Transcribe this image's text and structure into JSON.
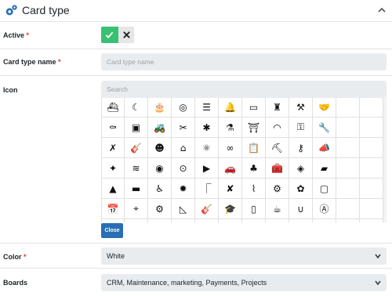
{
  "header": {
    "title": "Card type"
  },
  "form": {
    "active": {
      "label": "Active",
      "required": "*"
    },
    "name": {
      "label": "Card type name",
      "required": "*",
      "placeholder": "Card type name"
    },
    "icon": {
      "label": "Icon",
      "search_placeholder": "Search"
    },
    "close_label": "Close",
    "color": {
      "label": "Color",
      "required": "*",
      "value": "White"
    },
    "boards": {
      "label": "Boards",
      "value": "CRM, Maintenance, marketing, Payments, Projects"
    }
  },
  "icons": [
    "ship-icon",
    "moon-icon",
    "cake-icon",
    "coins-icon",
    "sliders-icon",
    "bell-icon",
    "vr-glasses-icon",
    "lighthouse-icon",
    "gavel-icon",
    "handshake-icon",
    "extra-icon",
    "extra-icon",
    "coffin-icon",
    "window-icon",
    "tractor-icon",
    "tools-icon",
    "bug-icon",
    "flask-icon",
    "monument-icon",
    "wifi-icon",
    "fence-icon",
    "wrench-icon",
    "extra-icon",
    "extra-icon",
    "utensils-icon",
    "guitar-icon",
    "brain-icon",
    "mushroom-icon",
    "atom-icon",
    "binoculars-icon",
    "clipboard-icon",
    "excavator-icon",
    "key-icon",
    "megaphone-icon",
    "extra-icon",
    "extra-icon",
    "magic-wand-icon",
    "swimming-pool-icon",
    "dinosaur-icon",
    "search-user-icon",
    "play-circle-icon",
    "car-icon",
    "plant-icon",
    "toolbox-icon",
    "compass-icon",
    "wallet-icon",
    "extra-icon",
    "extra-icon",
    "traffic-cone-icon",
    "truck-icon",
    "wheelchair-icon",
    "gear-badge-icon",
    "pipe-icon",
    "ruler-pencil-icon",
    "shower-icon",
    "lawn-mower-icon",
    "frog-icon",
    "cube-icon",
    "extra-icon",
    "extra-icon",
    "calendar-check-icon",
    "telescope-icon",
    "engine-icon",
    "note-icon",
    "guitar-icon",
    "graduation-cap-icon",
    "door-icon",
    "cup-icon",
    "magnet-icon",
    "ai-icon",
    "extra-icon",
    "extra-icon",
    "misc-icon",
    "misc-icon",
    "misc-icon",
    "misc-icon",
    "misc-icon",
    "misc-icon",
    "misc-icon",
    "misc-icon",
    "misc-icon",
    "misc-icon",
    "misc-icon",
    "misc-icon"
  ],
  "icon_glyphs": [
    "⛴",
    "☾",
    "🎂",
    "◎",
    "☰",
    "🔔",
    "▭",
    "♜",
    "⚒",
    "🤝",
    "",
    "",
    "⚰",
    "▣",
    "🚜",
    "✂",
    "✱",
    "⚗",
    "⛩",
    "◠",
    "⚿",
    "🔧",
    "",
    "",
    "✗",
    "🎸",
    "☻",
    "⌂",
    "⚛",
    "∞",
    "📋",
    "⛏",
    "⚷",
    "📣",
    "",
    "",
    "✦",
    "≋",
    "◉",
    "⊙",
    "▶",
    "🚗",
    "♣",
    "🧰",
    "◈",
    "▰",
    "",
    "",
    "▲",
    "▬",
    "♿",
    "✹",
    "⎾",
    "✘",
    "⌇",
    "⚙",
    "✿",
    "▢",
    "",
    "",
    "📅",
    "⌖",
    "⚙",
    "◺",
    "🎸",
    "🎓",
    "▯",
    "☕",
    "∪",
    "Ⓐ",
    "",
    "",
    "",
    "",
    "",
    "",
    "",
    "",
    "",
    "",
    "",
    "",
    "",
    ""
  ]
}
